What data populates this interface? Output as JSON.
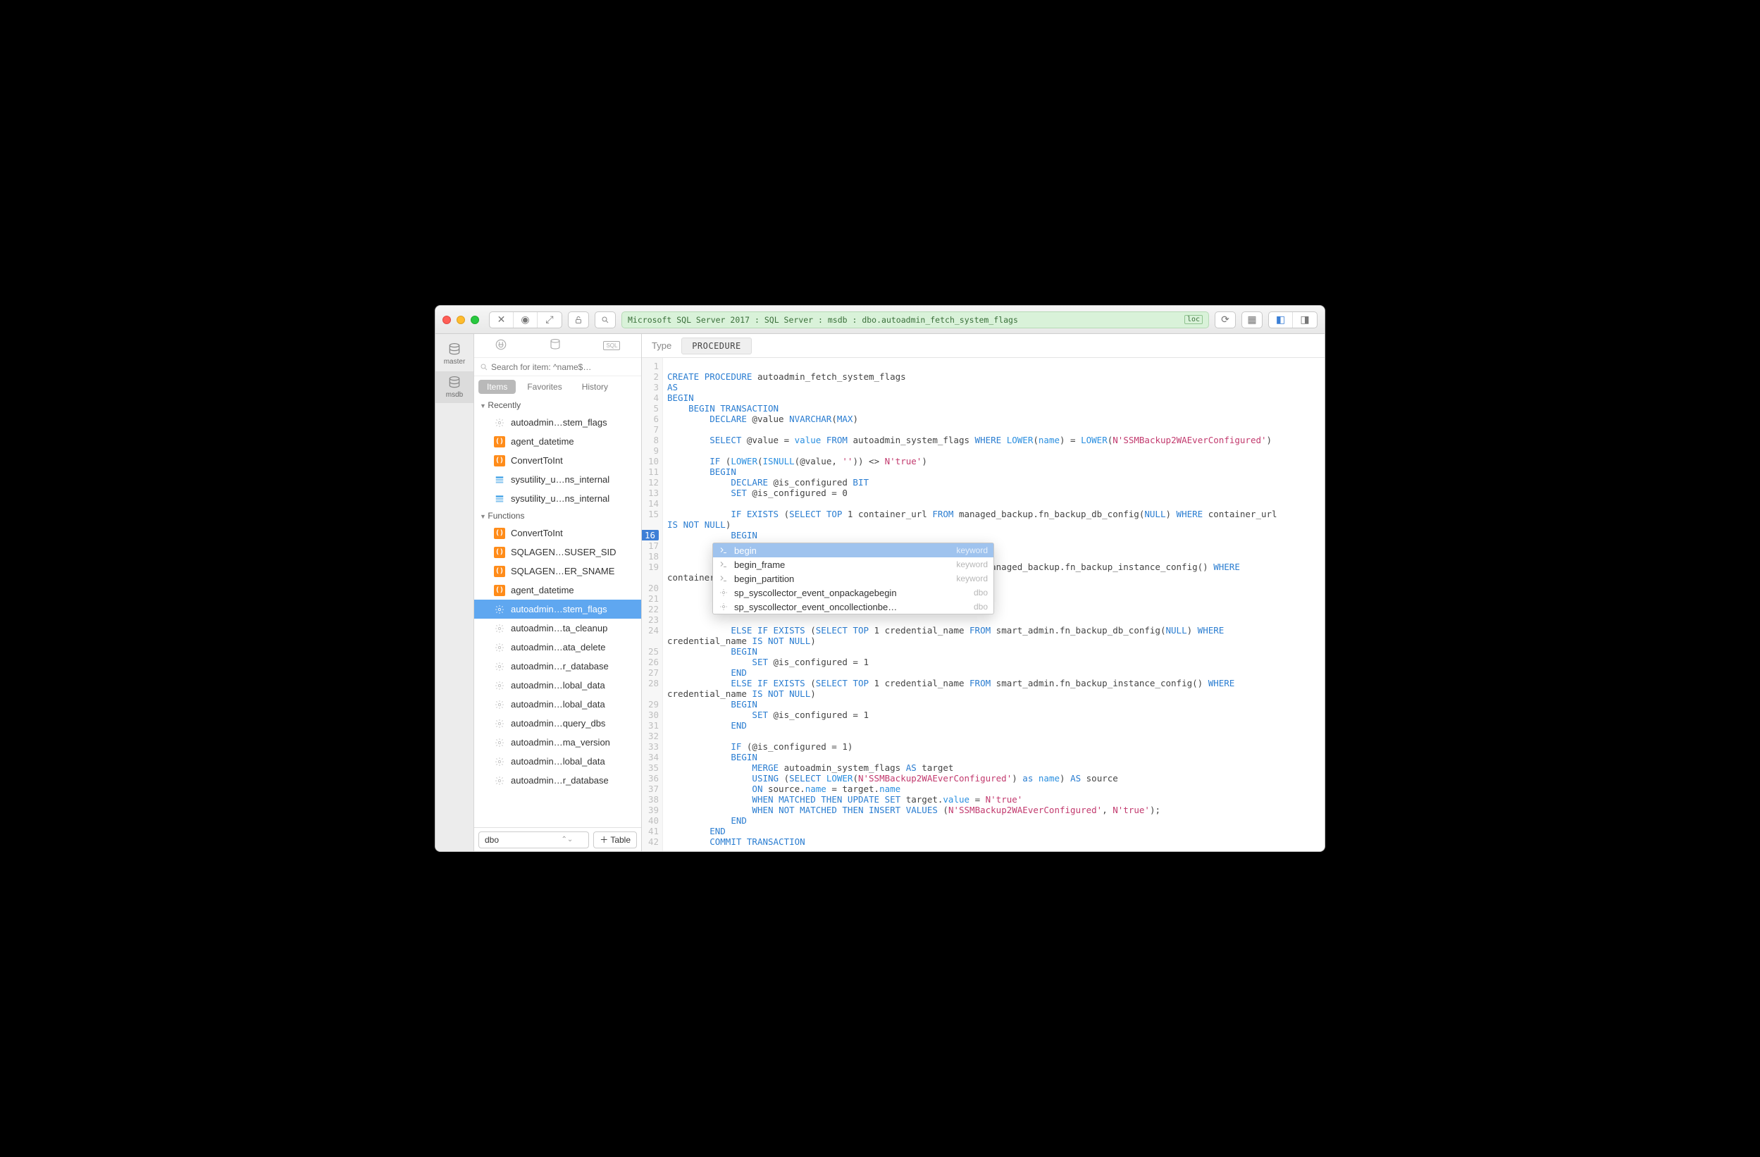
{
  "breadcrumb": "Microsoft SQL Server 2017 : SQL Server : msdb : dbo.autoadmin_fetch_system_flags",
  "breadcrumb_badge": "loc",
  "rail": [
    {
      "label": "master"
    },
    {
      "label": "msdb"
    }
  ],
  "sidebar": {
    "search_placeholder": "Search for item: ^name$…",
    "tabs": {
      "items": "Items",
      "favorites": "Favorites",
      "history": "History"
    },
    "sections": {
      "recently": {
        "title": "Recently",
        "items": [
          {
            "icon": "gear",
            "label": "autoadmin…stem_flags"
          },
          {
            "icon": "fn",
            "label": "agent_datetime"
          },
          {
            "icon": "fn",
            "label": "ConvertToInt"
          },
          {
            "icon": "tbl",
            "label": "sysutility_u…ns_internal"
          },
          {
            "icon": "tbl",
            "label": "sysutility_u…ns_internal"
          }
        ]
      },
      "functions": {
        "title": "Functions",
        "items": [
          {
            "icon": "fn",
            "label": "ConvertToInt"
          },
          {
            "icon": "fn",
            "label": "SQLAGEN…SUSER_SID"
          },
          {
            "icon": "fn",
            "label": "SQLAGEN…ER_SNAME"
          },
          {
            "icon": "fn",
            "label": "agent_datetime"
          },
          {
            "icon": "gear",
            "label": "autoadmin…stem_flags",
            "selected": true
          },
          {
            "icon": "gear",
            "label": "autoadmin…ta_cleanup"
          },
          {
            "icon": "gear",
            "label": "autoadmin…ata_delete"
          },
          {
            "icon": "gear",
            "label": "autoadmin…r_database"
          },
          {
            "icon": "gear",
            "label": "autoadmin…lobal_data"
          },
          {
            "icon": "gear",
            "label": "autoadmin…lobal_data"
          },
          {
            "icon": "gear",
            "label": "autoadmin…query_dbs"
          },
          {
            "icon": "gear",
            "label": "autoadmin…ma_version"
          },
          {
            "icon": "gear",
            "label": "autoadmin…lobal_data"
          },
          {
            "icon": "gear",
            "label": "autoadmin…r_database"
          }
        ]
      }
    },
    "footer": {
      "schema": "dbo",
      "add_table": "Table"
    }
  },
  "editor": {
    "type_label": "Type",
    "type_value": "PROCEDURE",
    "highlight_line": 16,
    "lines": [
      "",
      "CREATE PROCEDURE autoadmin_fetch_system_flags",
      "AS",
      "BEGIN",
      "    BEGIN TRANSACTION",
      "        DECLARE @value NVARCHAR(MAX)",
      "",
      "        SELECT @value = value FROM autoadmin_system_flags WHERE LOWER(name) = LOWER(N'SSMBackup2WAEverConfigured')",
      "",
      "        IF (LOWER(ISNULL(@value, '')) <> N'true')",
      "        BEGIN",
      "            DECLARE @is_configured BIT",
      "            SET @is_configured = 0",
      "",
      "            IF EXISTS (SELECT TOP 1 container_url FROM managed_backup.fn_backup_db_config(NULL) WHERE container_url",
      "IS NOT NULL)",
      "            BEGIN",
      "",
      "",
      "            ELSE IF EXISTS (SELECT TOP 1 container_url FROM managed_backup.fn_backup_instance_config() WHERE",
      "container_url IS NOT NULL)",
      "",
      "",
      "",
      "",
      "            ELSE IF EXISTS (SELECT TOP 1 credential_name FROM smart_admin.fn_backup_db_config(NULL) WHERE",
      "credential_name IS NOT NULL)",
      "            BEGIN",
      "                SET @is_configured = 1",
      "            END",
      "            ELSE IF EXISTS (SELECT TOP 1 credential_name FROM smart_admin.fn_backup_instance_config() WHERE",
      "credential_name IS NOT NULL)",
      "            BEGIN",
      "                SET @is_configured = 1",
      "            END",
      "",
      "            IF (@is_configured = 1)",
      "            BEGIN",
      "                MERGE autoadmin_system_flags AS target",
      "                USING (SELECT LOWER(N'SSMBackup2WAEverConfigured') as name) AS source",
      "                ON source.name = target.name",
      "                WHEN MATCHED THEN UPDATE SET target.value = N'true'",
      "                WHEN NOT MATCHED THEN INSERT VALUES (N'SSMBackup2WAEverConfigured', N'true');",
      "            END",
      "        END",
      "        COMMIT TRANSACTION"
    ]
  },
  "autocomplete": {
    "items": [
      {
        "label": "begin",
        "kind": "keyword",
        "selected": true
      },
      {
        "label": "begin_frame",
        "kind": "keyword"
      },
      {
        "label": "begin_partition",
        "kind": "keyword"
      },
      {
        "label": "sp_syscollector_event_onpackagebegin",
        "kind": "dbo"
      },
      {
        "label": "sp_syscollector_event_oncollectionbe…",
        "kind": "dbo"
      }
    ]
  }
}
